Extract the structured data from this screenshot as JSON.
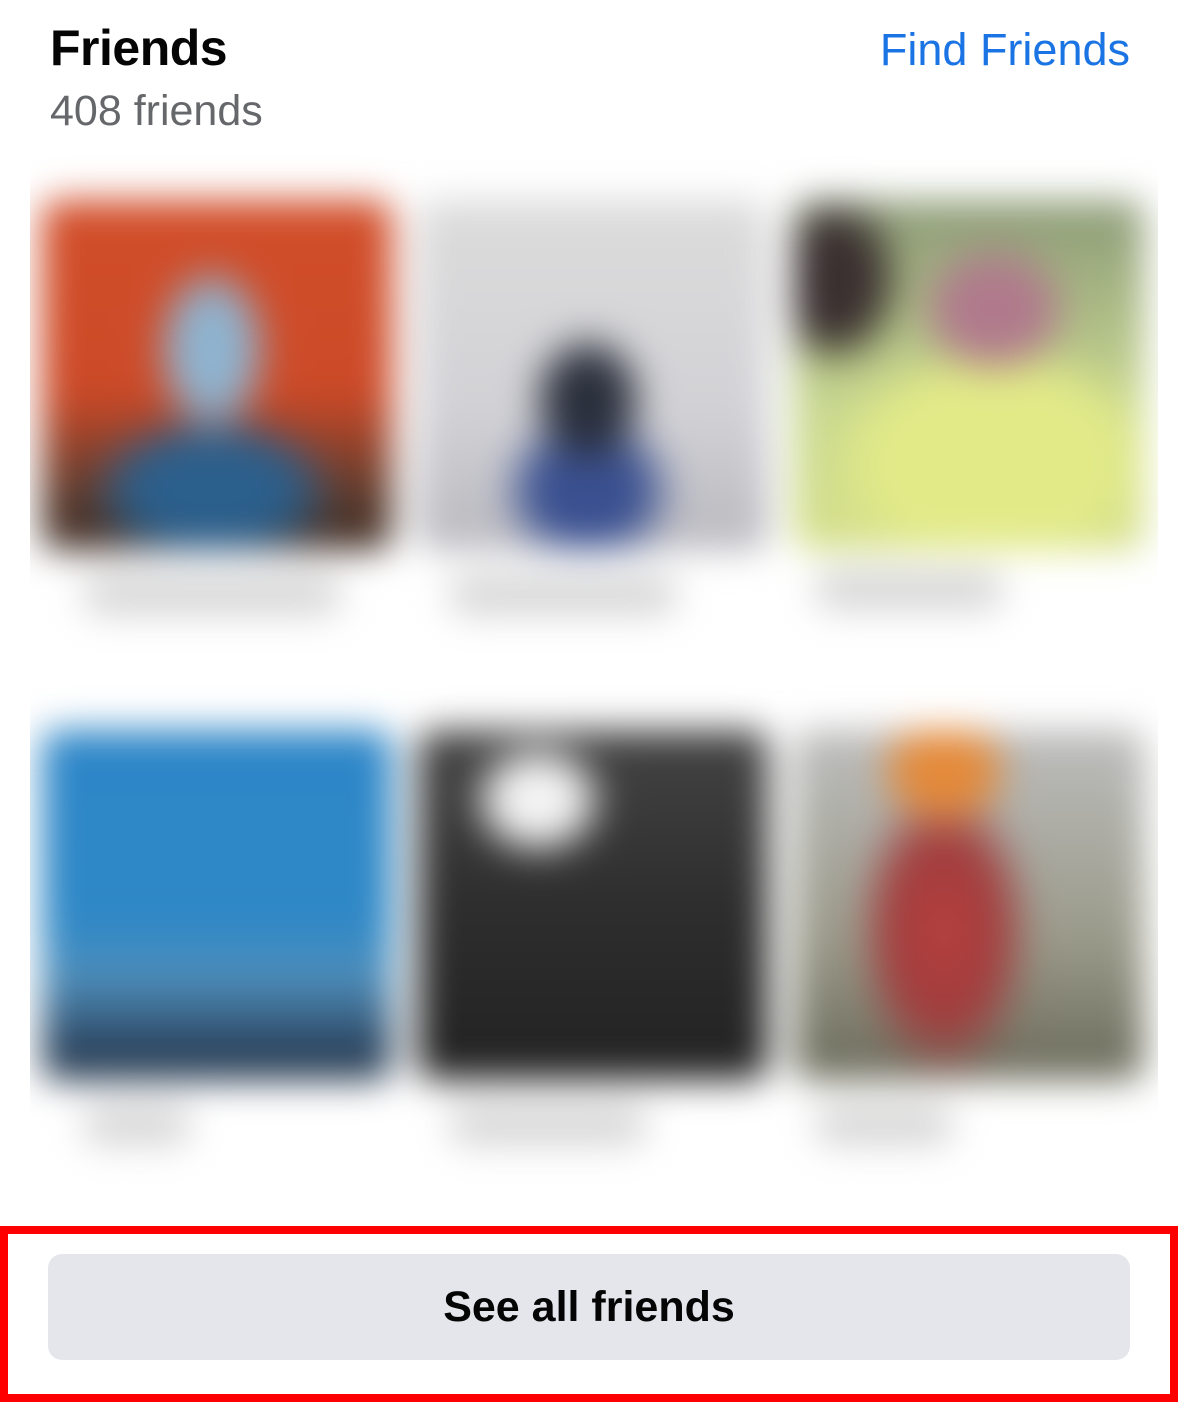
{
  "header": {
    "title": "Friends",
    "friend_count": "408 friends",
    "find_friends_label": "Find Friends"
  },
  "friends_grid": {
    "tiles": [
      {
        "name": ""
      },
      {
        "name": ""
      },
      {
        "name": ""
      },
      {
        "name": ""
      },
      {
        "name": ""
      },
      {
        "name": ""
      }
    ]
  },
  "actions": {
    "see_all_label": "See all friends"
  },
  "colors": {
    "link": "#1b74e4",
    "button_bg": "#e4e6eb",
    "highlight": "#ff0000",
    "secondary_text": "#65676b"
  }
}
